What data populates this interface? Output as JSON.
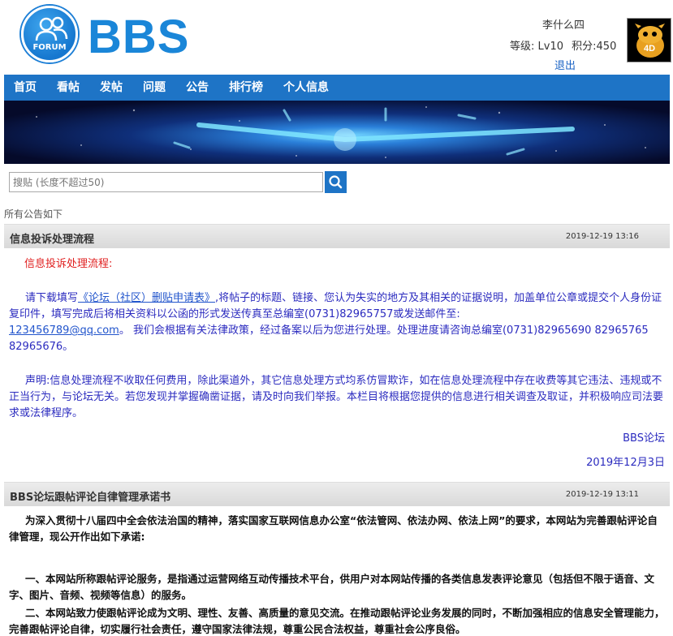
{
  "header": {
    "logo_badge": "FORUM",
    "logo_text": "BBS",
    "user_name": "李什么四",
    "level_label": "等级: Lv10",
    "points_label": "积分:450",
    "logout_label": "退出",
    "avatar_text": "4D"
  },
  "nav": {
    "items": [
      "首页",
      "看帖",
      "发帖",
      "问题",
      "公告",
      "排行榜",
      "个人信息"
    ]
  },
  "search": {
    "placeholder": "搜贴 (长度不超过50)"
  },
  "section_caption": "所有公告如下",
  "posts": [
    {
      "title": "信息投诉处理流程",
      "date": "2019-12-19 13:16",
      "heading": "信息投诉处理流程:",
      "para1_a": "请下载填写",
      "para1_link": "《论坛（社区）删贴申请表》",
      "para1_b": ",将帖子的标题、链接、您认为失实的地方及其相关的证据说明，加盖单位公章或提交个人身份证复印件，填写完成后将相关资料以公函的形式发送传真至总编室(0731)82965757或发送邮件至:",
      "email": "123456789@qq.com",
      "para1_c": "。 我们会根据有关法律政策，经过备案以后为您进行处理。处理进度请咨询总编室(0731)82965690 82965765 82965676。",
      "para2": "声明:信息处理流程不收取任何费用，除此渠道外，其它信息处理方式均系仿冒欺诈，如在信息处理流程中存在收费等其它违法、违规或不正当行为，与论坛无关。若您发现并掌握确凿证据，请及时向我们举报。本栏目将根据您提供的信息进行相关调查及取证，并积极响应司法要求或法律程序。",
      "signature": "BBS论坛",
      "sign_date": "2019年12月3日"
    },
    {
      "title": "BBS论坛跟帖评论自律管理承诺书",
      "date": "2019-12-19 13:11",
      "para1": "为深入贯彻十八届四中全会依法治国的精神，落实国家互联网信息办公室“依法管网、依法办网、依法上网”的要求，本网站为完善跟帖评论自律管理，现公开作出如下承诺:",
      "para2": "一、本网站所称跟帖评论服务，是指通过运营网络互动传播技术平台，供用户对本网站传播的各类信息发表评论意见（包括但不限于语音、文字、图片、音频、视频等信息）的服务。",
      "para3": "二、本网站致力使跟帖评论成为文明、理性、友善、高质量的意见交流。在推动跟帖评论业务发展的同时，不断加强相应的信息安全管理能力，完善跟帖评论自律，切实履行社会责任，遵守国家法律法规，尊重公民合法权益，尊重社会公序良俗。"
    }
  ],
  "colors": {
    "nav_bg": "#1e74c6",
    "logo_blue": "#1a86d8",
    "announce_text": "#2b2bbf",
    "heading_red": "#e02020"
  }
}
